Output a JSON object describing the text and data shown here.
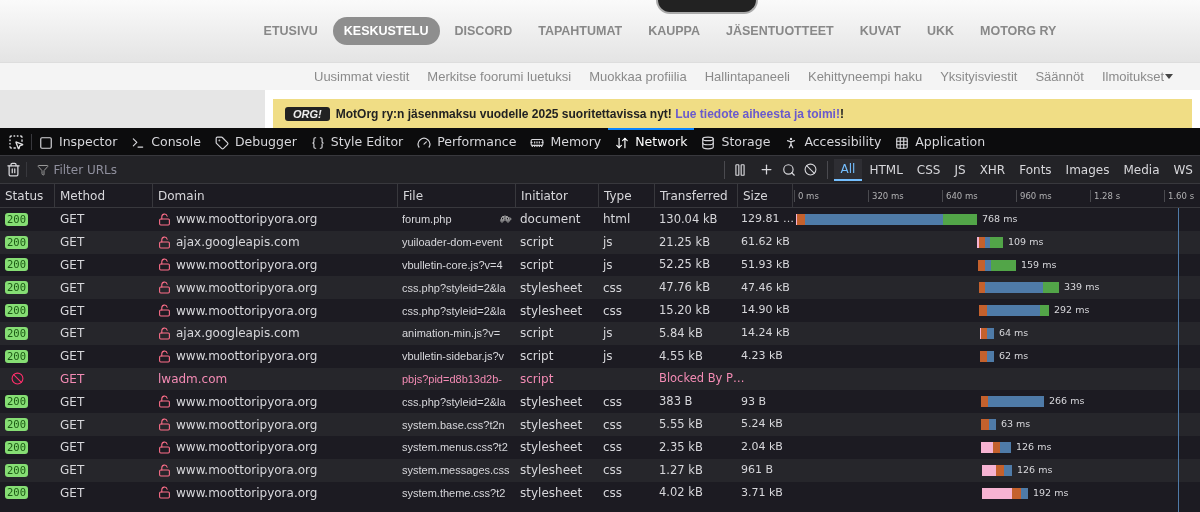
{
  "site": {
    "nav": [
      {
        "label": "ETUSIVU",
        "selected": false
      },
      {
        "label": "KESKUSTELU",
        "selected": true
      },
      {
        "label": "DISCORD",
        "selected": false
      },
      {
        "label": "TAPAHTUMAT",
        "selected": false
      },
      {
        "label": "KAUPPA",
        "selected": false
      },
      {
        "label": "JÄSENTUOTTEET",
        "selected": false
      },
      {
        "label": "KUVAT",
        "selected": false
      },
      {
        "label": "UKK",
        "selected": false
      },
      {
        "label": "MOTORG RY",
        "selected": false
      }
    ],
    "subnav": [
      {
        "label": "Uusimmat viestit"
      },
      {
        "label": "Merkitse foorumi luetuksi"
      },
      {
        "label": "Muokkaa profiilia"
      },
      {
        "label": "Hallintapaneeli"
      },
      {
        "label": "Kehittyneempi haku"
      },
      {
        "label": "Yksityisviestit"
      },
      {
        "label": "Säännöt"
      },
      {
        "label": "Ilmoitukset",
        "dropdown": true
      }
    ],
    "banner": {
      "logo": "ORG!",
      "text": "MotOrg ry:n jäsenmaksu vuodelle 2025 suoritettavissa nyt! ",
      "link": "Lue tiedote aiheesta ja toimi!",
      "after": "!"
    }
  },
  "devtools": {
    "tabs": [
      {
        "label": "Inspector",
        "selected": false
      },
      {
        "label": "Console",
        "selected": false
      },
      {
        "label": "Debugger",
        "selected": false
      },
      {
        "label": "Style Editor",
        "selected": false
      },
      {
        "label": "Performance",
        "selected": false
      },
      {
        "label": "Memory",
        "selected": false
      },
      {
        "label": "Network",
        "selected": true
      },
      {
        "label": "Storage",
        "selected": false
      },
      {
        "label": "Accessibility",
        "selected": false
      },
      {
        "label": "Application",
        "selected": false
      }
    ],
    "filter": {
      "placeholder": "Filter URLs"
    },
    "type_filters": [
      {
        "label": "All",
        "selected": true
      },
      {
        "label": "HTML",
        "selected": false
      },
      {
        "label": "CSS",
        "selected": false
      },
      {
        "label": "JS",
        "selected": false
      },
      {
        "label": "XHR",
        "selected": false
      },
      {
        "label": "Fonts",
        "selected": false
      },
      {
        "label": "Images",
        "selected": false
      },
      {
        "label": "Media",
        "selected": false
      },
      {
        "label": "WS",
        "selected": false
      }
    ],
    "columns": [
      "Status",
      "Method",
      "Domain",
      "File",
      "Initiator",
      "Type",
      "Transferred",
      "Size"
    ],
    "waterfall_ticks": [
      "0 ms",
      "320 ms",
      "640 ms",
      "960 ms",
      "1.28 s",
      "1.60 s"
    ],
    "rows": [
      {
        "kind": "ok",
        "status": "200",
        "method": "GET",
        "domain": "www.moottoripyora.org",
        "insecure": true,
        "file": "forum.php",
        "slow": true,
        "initiator": "document",
        "type": "html",
        "transferred": "130.04 kB",
        "size": "129.81 …",
        "timing": "768 ms"
      },
      {
        "kind": "ok",
        "status": "200",
        "method": "GET",
        "domain": "ajax.googleapis.com",
        "insecure": true,
        "file": "yuiloader-dom-event",
        "slow": false,
        "initiator": "script",
        "type": "js",
        "transferred": "21.25 kB",
        "size": "61.62 kB",
        "timing": "109 ms"
      },
      {
        "kind": "ok",
        "status": "200",
        "method": "GET",
        "domain": "www.moottoripyora.org",
        "insecure": true,
        "file": "vbulletin-core.js?v=4",
        "slow": false,
        "initiator": "script",
        "type": "js",
        "transferred": "52.25 kB",
        "size": "51.93 kB",
        "timing": "159 ms"
      },
      {
        "kind": "ok",
        "status": "200",
        "method": "GET",
        "domain": "www.moottoripyora.org",
        "insecure": true,
        "file": "css.php?styleid=2&la",
        "slow": false,
        "initiator": "stylesheet",
        "type": "css",
        "transferred": "47.76 kB",
        "size": "47.46 kB",
        "timing": "339 ms"
      },
      {
        "kind": "ok",
        "status": "200",
        "method": "GET",
        "domain": "www.moottoripyora.org",
        "insecure": true,
        "file": "css.php?styleid=2&la",
        "slow": false,
        "initiator": "stylesheet",
        "type": "css",
        "transferred": "15.20 kB",
        "size": "14.90 kB",
        "timing": "292 ms"
      },
      {
        "kind": "ok",
        "status": "200",
        "method": "GET",
        "domain": "ajax.googleapis.com",
        "insecure": true,
        "file": "animation-min.js?v=",
        "slow": false,
        "initiator": "script",
        "type": "js",
        "transferred": "5.84 kB",
        "size": "14.24 kB",
        "timing": "64 ms"
      },
      {
        "kind": "ok",
        "status": "200",
        "method": "GET",
        "domain": "www.moottoripyora.org",
        "insecure": true,
        "file": "vbulletin-sidebar.js?v",
        "slow": false,
        "initiator": "script",
        "type": "js",
        "transferred": "4.55 kB",
        "size": "4.23 kB",
        "timing": "62 ms"
      },
      {
        "kind": "blocked",
        "method": "GET",
        "domain": "lwadm.com",
        "insecure": false,
        "file": "pbjs?pid=d8b13d2b-",
        "slow": false,
        "initiator": "script",
        "transferred": "Blocked By P…"
      },
      {
        "kind": "ok",
        "status": "200",
        "method": "GET",
        "domain": "www.moottoripyora.org",
        "insecure": true,
        "file": "css.php?styleid=2&la",
        "slow": false,
        "initiator": "stylesheet",
        "type": "css",
        "transferred": "383 B",
        "size": "93 B",
        "timing": "266 ms"
      },
      {
        "kind": "ok",
        "status": "200",
        "method": "GET",
        "domain": "www.moottoripyora.org",
        "insecure": true,
        "file": "system.base.css?t2n",
        "slow": false,
        "initiator": "stylesheet",
        "type": "css",
        "transferred": "5.55 kB",
        "size": "5.24 kB",
        "timing": "63 ms"
      },
      {
        "kind": "ok",
        "status": "200",
        "method": "GET",
        "domain": "www.moottoripyora.org",
        "insecure": true,
        "file": "system.menus.css?t2",
        "slow": false,
        "initiator": "stylesheet",
        "type": "css",
        "transferred": "2.35 kB",
        "size": "2.04 kB",
        "timing": "126 ms"
      },
      {
        "kind": "ok",
        "status": "200",
        "method": "GET",
        "domain": "www.moottoripyora.org",
        "insecure": true,
        "file": "system.messages.css",
        "slow": false,
        "initiator": "stylesheet",
        "type": "css",
        "transferred": "1.27 kB",
        "size": "961 B",
        "timing": "126 ms"
      },
      {
        "kind": "ok",
        "status": "200",
        "method": "GET",
        "domain": "www.moottoripyora.org",
        "insecure": true,
        "file": "system.theme.css?t2",
        "slow": false,
        "initiator": "stylesheet",
        "type": "css",
        "transferred": "4.02 kB",
        "size": "3.71 kB",
        "timing": "192 ms"
      }
    ]
  }
}
